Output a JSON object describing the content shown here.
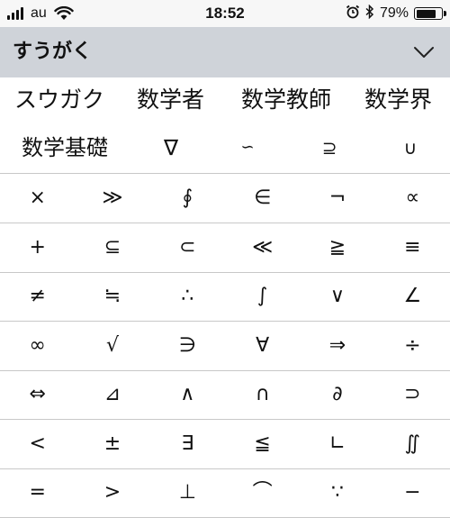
{
  "status_bar": {
    "carrier": "au",
    "time": "18:52",
    "battery_percent": "79%",
    "battery_level": 0.79,
    "icons": [
      "signal-icon",
      "wifi-icon",
      "alarm-icon",
      "bluetooth-icon",
      "battery-icon"
    ]
  },
  "keyboard": {
    "reading": "すうがく",
    "collapse_icon": "chevron-down-icon",
    "candidates_row1": [
      "スウガク",
      "数学者",
      "数学教師",
      "数学界"
    ],
    "candidates_row2": [
      "数学基礎",
      "∇",
      "∽",
      "⊇",
      "∪"
    ],
    "symbol_rows": [
      [
        "×",
        "≫",
        "∮",
        "∈",
        "¬",
        "∝"
      ],
      [
        "+",
        "⊆",
        "⊂",
        "≪",
        "≧",
        "≡"
      ],
      [
        "≠",
        "≒",
        "∴",
        "∫",
        "∨",
        "∠"
      ],
      [
        "∞",
        "√",
        "∋",
        "∀",
        "⇒",
        "÷"
      ],
      [
        "⇔",
        "⊿",
        "∧",
        "∩",
        "∂",
        "⊃"
      ],
      [
        "<",
        "±",
        "∃",
        "≦",
        "∟",
        "∬"
      ],
      [
        "=",
        ">",
        "⊥",
        "⌒",
        "∵",
        "−"
      ]
    ],
    "colors": {
      "header_bg": "#cfd3d9",
      "divider": "#c8c8c8",
      "text": "#111111"
    }
  }
}
